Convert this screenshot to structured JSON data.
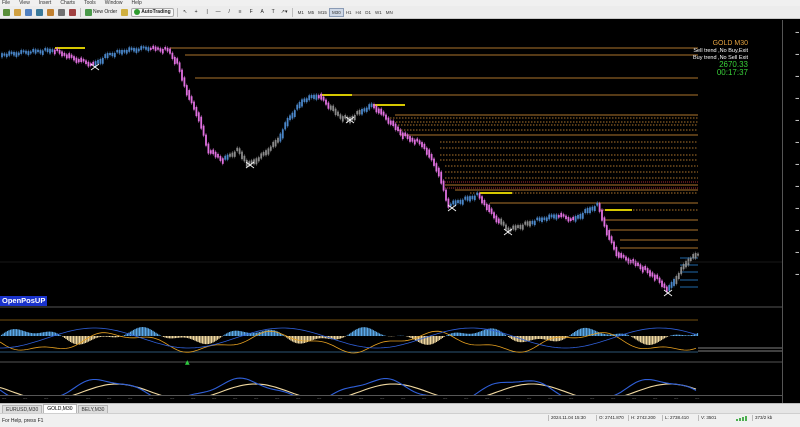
{
  "menu": [
    "File",
    "View",
    "Insert",
    "Charts",
    "Tools",
    "Window",
    "Help"
  ],
  "toolbar": {
    "new_order": "New Order",
    "autotrading": "AutoTrading",
    "timeframes": [
      "M1",
      "M5",
      "M15",
      "M30",
      "H1",
      "H4",
      "D1",
      "W1",
      "MN"
    ],
    "active_timeframe": "M30"
  },
  "chart": {
    "symbol_label": "GOLD   M30",
    "sell_trend": "Sell trend ,No Buy,Exit",
    "buy_trend": "Buy trend ,No Sell Exit",
    "price": "2670.33",
    "timer": "00:17:37",
    "indicator_label": "OpenPosUP",
    "colors": {
      "bull": "#4a86c8",
      "bear": "#e070e0",
      "neutral": "#8a8a8a",
      "level_orange": "#e59a3a",
      "level_red": "#e04040",
      "level_yellow": "#f5e400",
      "level_blue": "#2a8ae0",
      "osc_orange": "#e6a020",
      "osc_blue": "#5aa8e8",
      "osc2_blue": "#2f5fd8",
      "osc2_cream": "#f0d8a0"
    }
  },
  "tabs": [
    "EURUSD,M30",
    "GOLD,M30",
    "BELY,M30"
  ],
  "active_tab": "GOLD,M30",
  "status": {
    "help": "For Help, press F1",
    "datetime": "2024.11.04 15:30",
    "open": "O: 2741.870",
    "high": "H: 2742.200",
    "low": "L: 2738.410",
    "volume": "V: 3501",
    "traffic": "373/2 kb"
  }
}
